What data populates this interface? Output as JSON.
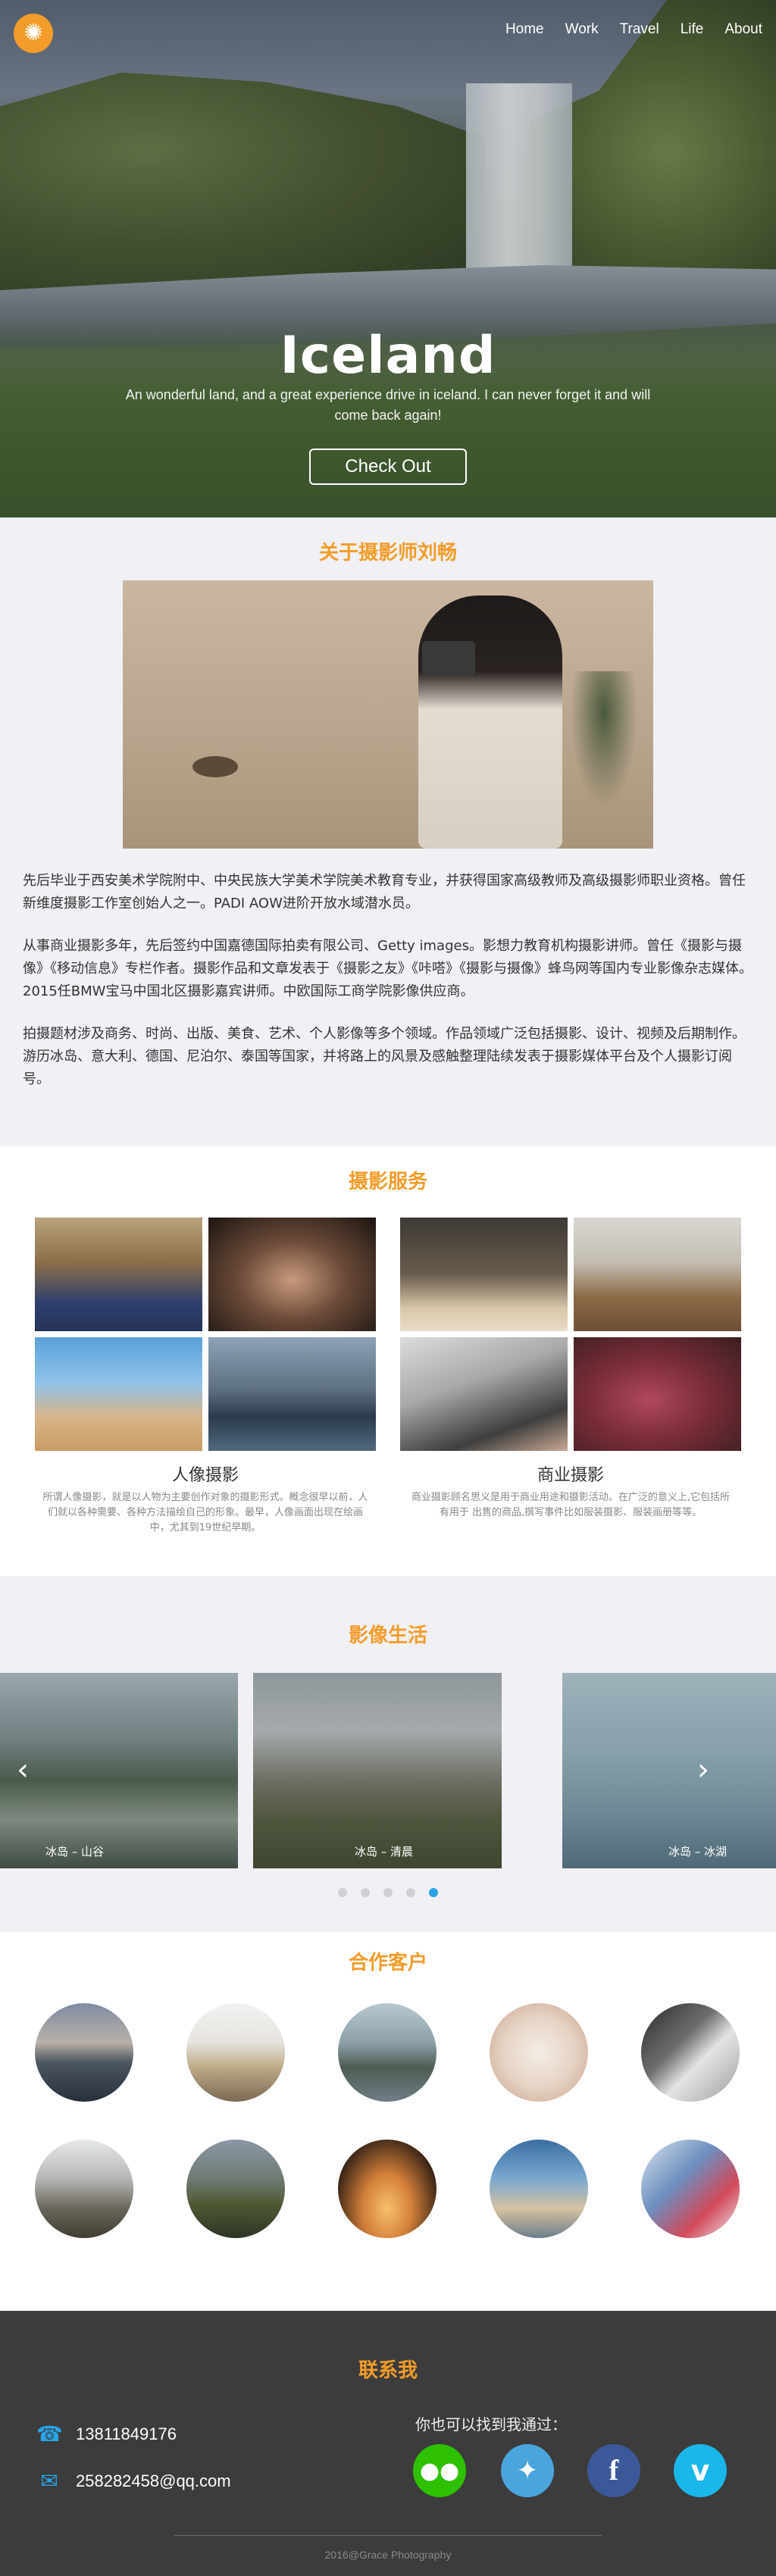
{
  "nav": {
    "items": [
      "Home",
      "Work",
      "Travel",
      "Life",
      "About"
    ]
  },
  "hero": {
    "title": "Iceland",
    "subtitle": "An wonderful land, and a great experience drive in iceland. I can never forget it and will come back again!",
    "button": "Check Out"
  },
  "about": {
    "title": "关于摄影师刘畅",
    "paragraphs": [
      "先后毕业于西安美术学院附中、中央民族大学美术学院美术教育专业，并获得国家高级教师及高级摄影师职业资格。曾任新维度摄影工作室创始人之一。PADI AOW进阶开放水域潜水员。",
      "从事商业摄影多年，先后签约中国嘉德国际拍卖有限公司、Getty images。影想力教育机构摄影讲师。曾任《摄影与摄像》《移动信息》专栏作者。摄影作品和文章发表于《摄影之友》《咔嗒》《摄影与摄像》蜂鸟网等国内专业影像杂志媒体。2015任BMW宝马中国北区摄影嘉宾讲师。中欧国际工商学院影像供应商。",
      "拍摄题材涉及商务、时尚、出版、美食、艺术、个人影像等多个领域。作品领域广泛包括摄影、设计、视频及后期制作。游历冰岛、意大利、德国、尼泊尔、泰国等国家，并将路上的风景及感触整理陆续发表于摄影媒体平台及个人摄影订阅号。"
    ]
  },
  "services": {
    "title": "摄影服务",
    "groups": [
      {
        "name": "人像摄影",
        "desc": "所谓人像摄影，就是以人物为主要创作对象的摄影形式。概念很早以前，人们就以各种需要、各种方法描绘自己的形象。最早，人像画面出现在绘画中，尤其到19世纪早期。"
      },
      {
        "name": "商业摄影",
        "desc": "商业摄影顾名思义是用于商业用途和摄影活动。在广泛的意义上,它包括所有用于 出售的商品,撰写事件比如服装摄影、服装画册等等。"
      }
    ]
  },
  "life": {
    "title": "影像生活",
    "slides": [
      {
        "caption": "冰岛 – 山谷"
      },
      {
        "caption": "冰岛 – 清晨"
      },
      {
        "caption": "冰岛 – 冰湖"
      }
    ],
    "dot_count": 5,
    "active_dot": 5
  },
  "clients": {
    "title": "合作客户"
  },
  "contact": {
    "title": "联系我",
    "phone": "13811849176",
    "email": "258282458@qq.com",
    "find_me": "你也可以找到我通过：",
    "socials": [
      "wechat-icon",
      "twitter-icon",
      "facebook-icon",
      "vimeo-icon"
    ],
    "copyright": "2016@Grace Photography"
  },
  "colors": {
    "accent": "#f39c29",
    "link_blue": "#29a3e6",
    "footer_bg": "#3c3c3c",
    "section_bg": "#f0f0f5"
  }
}
